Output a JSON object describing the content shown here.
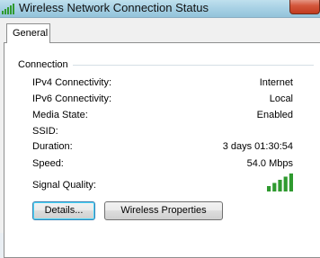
{
  "window": {
    "title": "Wireless Network Connection Status"
  },
  "tabs": [
    {
      "label": "General",
      "selected": true
    }
  ],
  "connection": {
    "heading": "Connection",
    "rows": [
      {
        "label": "IPv4 Connectivity:",
        "value": "Internet"
      },
      {
        "label": "IPv6 Connectivity:",
        "value": "Local"
      },
      {
        "label": "Media State:",
        "value": "Enabled"
      },
      {
        "label": "SSID:",
        "value": ""
      },
      {
        "label": "Duration:",
        "value": "3 days 01:30:54"
      },
      {
        "label": "Speed:",
        "value": "54.0 Mbps"
      }
    ],
    "signal_label": "Signal Quality:",
    "signal_bars_filled": 5,
    "signal_bars_total": 5
  },
  "buttons": {
    "details": "Details...",
    "wireless_properties": "Wireless Properties"
  },
  "colors": {
    "signal_green": "#2f9a2f",
    "titlebar": "#a9d2e5",
    "close_red": "#c94a2f"
  },
  "icons": {
    "title_icon": "signal-strength-icon",
    "close": "close-icon"
  }
}
